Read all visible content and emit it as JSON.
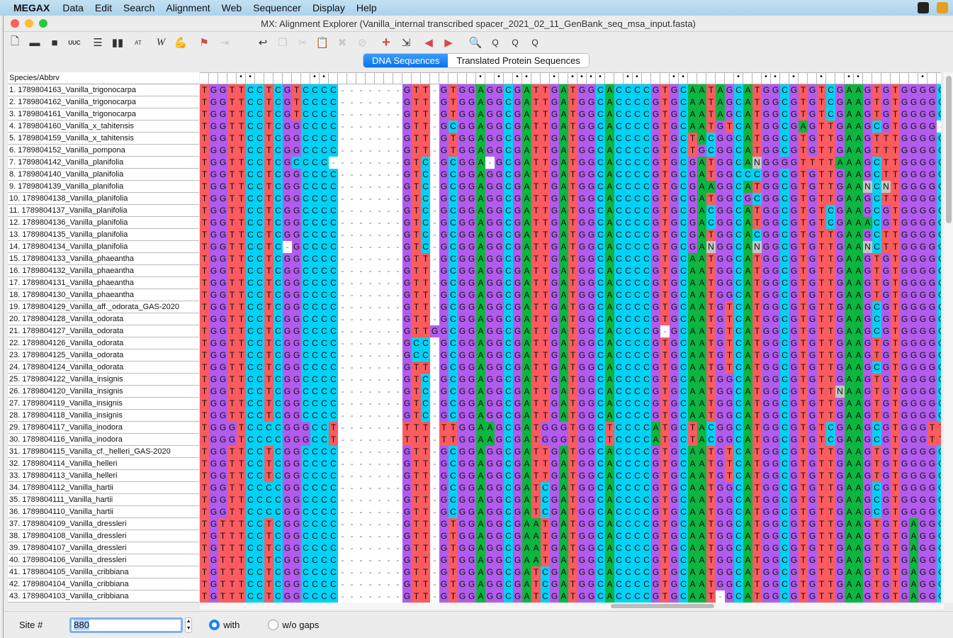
{
  "menubar": {
    "app": "MEGAX",
    "items": [
      "Data",
      "Edit",
      "Search",
      "Alignment",
      "Web",
      "Sequencer",
      "Display",
      "Help"
    ],
    "right_icons": [
      "camera-icon",
      "shield-icon"
    ]
  },
  "window": {
    "title": "MX: Alignment Explorer (Vanilla_internal transcribed spacer_2021_02_11_GenBank_seq_msa_input.fasta)"
  },
  "toolbar": {
    "icons": [
      "new-icon",
      "open-folder-icon",
      "save-icon",
      "translate-icon",
      "document-icon",
      "split-icon",
      "atcg-icon",
      "w-icon",
      "muscle-icon",
      "flag-icon",
      "insert-gap-icon",
      "undo-icon",
      "copy-icon",
      "cut-icon",
      "paste-icon",
      "delete-icon",
      "delete-gap-icon",
      "add-icon",
      "import-icon",
      "move-left-icon",
      "move-right-icon",
      "search-icon",
      "search-previous-icon",
      "search-next-icon",
      "search-flag-icon"
    ]
  },
  "tabs": [
    {
      "label": "DNA Sequences",
      "active": true
    },
    {
      "label": "Translated Protein Sequences",
      "active": false
    }
  ],
  "colors": {
    "A": "#0cb640",
    "C": "#00d2f6",
    "G": "#b25ced",
    "T": "#fc5b60",
    "N": "#c4c4c4",
    "-": "#ffffff"
  },
  "alignment": {
    "header": "Species/Abbrv",
    "conserved": "    **      **                * * **  * ****  **   **     *  ** *  *  **      *  ",
    "rows": [
      {
        "name": "1. 1789804163_Vanilla_trigonocarpa",
        "seq": "TGGTTCCTCGTCCCC-------GTT-GTGGAGGCGATTGATGGCACCCCGTGCAATAGCATGGCGTGTCGAAGTGTGGGGC"
      },
      {
        "name": "2. 1789804162_Vanilla_trigonocarpa",
        "seq": "TGGTTCCTCGTCCCC-------GTT-GTGGAGGCGATTGATGGCACCCCGTGCAATAGCATGGCGTGTCGAAGTGTGGGGC"
      },
      {
        "name": "3. 1789804161_Vanilla_trigonocarpa",
        "seq": "TGGTTCCTCGTCCCC-------GTT-GTGGAGGCGATTGATGGCACCCCGTGCAATAGCATGGCGTGTCGAAGTGTGGGGC"
      },
      {
        "name": "4. 1789804160_Vanilla_x_tahitensis",
        "seq": "TGGTTCCTCGGCCCC-------GTT-GCGGAGGCGATTGATGGCACCCCGTGCAATGTCATGGCGAGTTGAAGCGTGGGG-"
      },
      {
        "name": "5. 1789804159_Vanilla_x_tahitensis",
        "seq": "TGGTTCCTCGGCCCC-------GTT-GTGGAGGCGATTGATGGCACCCCGTGCTACGGCATGGCGTGTTGAAGTTTGGGGC"
      },
      {
        "name": "6. 1789804152_Vanilla_pompona",
        "seq": "TGGTTCCTCGGCCCC-------GTT-GTGGAGGCGATTGATGGCACCCCGTGCTGCGGCATGGCGTGTTGAAGTTTGGGGC"
      },
      {
        "name": "7. 1789804142_Vanilla_planifolia",
        "seq": "TGGTTCCTCGCCCC--------GTC-GCGGA-GCGATTGATGGCACCCCGTGCGATGGCANGGGGTTTTAAAGCTTGGGGC"
      },
      {
        "name": "8. 1789804140_Vanilla_planifolia",
        "seq": "TGGTTCCTCGGCCCC-------GTC-GCGGAGGCGATTGATGGCACCCCGTGCGATGGCCCGGCGTGTTGAAGCTTGGGGC"
      },
      {
        "name": "9. 1789804139_Vanilla_planifolia",
        "seq": "TGGTTCCTCGGCCCC-------GTC-GCGGAGGCGATTGATGGCACCCCGTGCGAAGGCATGGCGTGTTGAANCNTGGGGC"
      },
      {
        "name": "10. 1789804138_Vanilla_planifolia",
        "seq": "TGGTTCCTCGGCCCC-------GTC-GCGGAGGCGATTGATGGCACCCCGTGCGATGGCGCGGCGTGTTGAAGCTTGGGGC"
      },
      {
        "name": "11. 1789804137_Vanilla_planifolia",
        "seq": "TGGTTCCTCGGCCCC-------GTC-GCGGAGGCGATTGATGGCACCCCGTGCGACGGCATGGCGTGTCGAAGCGTGGGGC"
      },
      {
        "name": "12. 1789804136_Vanilla_planifolia",
        "seq": "TGGTTCCTCGGCCCC-------GTC-GCGGAGGCGATTGATGGCACCCCGTGCGACGGCATGGCGTGTCGAAACGTGGGGC"
      },
      {
        "name": "13. 1789804135_Vanilla_planifolia",
        "seq": "TGGTTCCTCGGCCCC-------GTC-GCGGAGGCGATTGATGGCACCCCGTGCGATGGCACGGCGTGTTGAAGCTTGGGGC"
      },
      {
        "name": "14. 1789804134_Vanilla_planifolia",
        "seq": "TGGTTCCTC-GCCCC-------GTC-GCGGAGGCGATTGATGGCACCCCGTGCGANGGCANGGCGTGTTGAANCTTGGGGC"
      },
      {
        "name": "15. 1789804133_Vanilla_phaeantha",
        "seq": "TGGTTCCTCGGCCCC-------GTT-GCGGAGGCGATTGATGGCACCCCGTGCAATGGCATGGCGTGTTGAAGTGTGGGGC"
      },
      {
        "name": "16. 1789804132_Vanilla_phaeantha",
        "seq": "TGGTTCCTCGGCCCC-------GTT-GCGGAGGCGATTGATGGCACCCCGTGCAATGGCATGGCGTGTTGAAGTGTGGGGC"
      },
      {
        "name": "17. 1789804131_Vanilla_phaeantha",
        "seq": "TGGTTCCTCGGCCCC-------GTT-GCGGAGGCGATTGATGGCACCCCGTGCAATGGCATGGCGTGTTGAAGTGTGGGGC"
      },
      {
        "name": "18. 1789804130_Vanilla_phaeantha",
        "seq": "TGGTTCCTCGGCCCC-------GTT-GCGGAGGCGATTGATGGCACCCCGTGCAATGGCATGGCGTGTTGAAGTGTGGGGC"
      },
      {
        "name": "19. 1789804129_Vanilla_aff._odorata_GAS-2020",
        "seq": "TGGTTCCTCGGCCCC-------GTT-GCGGAGGCGATTGATGGCACCCCGTGCAATGTCATGGCGTGTTGAAGCGTGGGGC"
      },
      {
        "name": "20. 1789804128_Vanilla_odorata",
        "seq": "TGGTTCCTCGGCCCC-------GTT-GCGGAGGCGATTGATGGCACCCCGTGCAATGTCATGGCGTGTTGAAGCGTGGGGC"
      },
      {
        "name": "21. 1789804127_Vanilla_odorata",
        "seq": "TGGTTCCTCGGCCCC-------GTTGGCGGAGGCGATTGATGGCACCCCG-GCAATGTCATGGCGTGTTGAAGCGTGGGGC"
      },
      {
        "name": "22. 1789804126_Vanilla_odorata",
        "seq": "TGGTTCCTCGGCCCC-------GCC-GCGGAGGCGATTGATGGCACCCCGTGCAATGTCATGGCGTGTTGAAGTGTGGGGC"
      },
      {
        "name": "23. 1789804125_Vanilla_odorata",
        "seq": "TGGTTCCTCGGCCCC-------GCC-GCGGAGGCGATTGATGGCACCCCGTGCAATGTCATGGCGTGTTGAAGTGTGGGGC"
      },
      {
        "name": "24. 1789804124_Vanilla_odorata",
        "seq": "TGGTTCCTCGGCCCC-------GTT-GCGGAGGCGATTGATGGCACCCCGTGCAATGTCATGGCGTGTTGAAGCGTGGGGC"
      },
      {
        "name": "25. 1789804122_Vanilla_insignis",
        "seq": "TGGTTCCTCGGCCCC-------GTC-GCGGAGGCGATTGATGGCACCCCGTGCAATGGCATGGCGTGTTGAAGTGTGGGGC"
      },
      {
        "name": "26. 1789804120_Vanilla_insignis",
        "seq": "TGGTTCCTCGGCCCC-------GTC-GCGGAGGCGATTGATGGCACCCCGTGCAATGGCATGGCGTGTTNAAGTGTGGGGC"
      },
      {
        "name": "27. 1789804119_Vanilla_insignis",
        "seq": "TGGTTCCTCGGCCCC-------GTC-GCGGAGGCGATTGATGGCACCCCGTGCAATGGCATGGCGTGTTGAAGTGTGGGGC"
      },
      {
        "name": "28. 1789804118_Vanilla_insignis",
        "seq": "TGGTTCCTCGGCCCC-------GTC-GCGGAGGCGATTGATGGCACCCCGTGCAATGGCATGGCGTGTTGAAGTGTGGGGC"
      },
      {
        "name": "29. 1789804117_Vanilla_inodora",
        "seq": "TGGGTCCCCGGGCCT-------TTT-TTGGAAGCGATGGGTGGCTCCCCATGCTACGGCATGGCGTGTCGAAGCGTGGGTT"
      },
      {
        "name": "30. 1789804116_Vanilla_inodora",
        "seq": "TGGGTCCCCGGGCCT-------TTT-TTGGAAGCGATGGGTGGCTCCCCATGCTACGGCATGGCGTGTCGAAGCGTGGGTT"
      },
      {
        "name": "31. 1789804115_Vanilla_cf._helleri_GAS-2020",
        "seq": "TGGTTCCTCGGCCCC-------GTT-GCGGAGGCGATTGATGGCACCCCGTGCAATGTCATGGCGTGTTGAAGTGTGGGGC"
      },
      {
        "name": "32. 1789804114_Vanilla_helleri",
        "seq": "TGGTTCCTCGGCCCC-------GTT-GCGGAGGCGATTGATGGCACCCCGTGCAATGTCATGGCGTGTTGAAGTGTGGGGC"
      },
      {
        "name": "33. 1789804113_Vanilla_helleri",
        "seq": "TGGTTCCTCGGCCCC-------GTT-GCGGAGGCGATTGATGGCACCCCGTGCAATGTCATGGCGTGTTGAAGTGTGGGGC"
      },
      {
        "name": "34. 1789804112_Vanilla_hartii",
        "seq": "TGGTTCCCCGGCCCC-------GTT-GCGGAGGCGATCGATGGCACCCCGTGCAATGGCATGGCGTGTTGAAGCGTGGGGC"
      },
      {
        "name": "35. 1789804111_Vanilla_hartii",
        "seq": "TGGTTCCCCGGCCCC-------GTT-GCGGAGGCGATCGATGGCACCCCGTGCAATGGCATGGCGTGTTGAAGCGTGGGGC"
      },
      {
        "name": "36. 1789804110_Vanilla_hartii",
        "seq": "TGGTTCCCCGGCCCC-------GTT-GCGGAGGCGATCGATGGCACCCCGTGCAATGGCATGGCGTGTTGAAGCGTGGGGC"
      },
      {
        "name": "37. 1789804109_Vanilla_dressleri",
        "seq": "TGTTTCCTCGGCCCC-------GTT-GTGGAGGCGAATGATGGCACCCCGTGCAATGGCATGGCGTGTTGAAGTGTGAGGC"
      },
      {
        "name": "38. 1789804108_Vanilla_dressleri",
        "seq": "TGTTTCCTCGGCCCC-------GTT-GTGGAGGCGAATGATGGCACCCCGTGCAATGGCATGGCGTGTTGAAGTGTGAGGC"
      },
      {
        "name": "39. 1789804107_Vanilla_dressleri",
        "seq": "TGTTTCCTCGGCCCC-------GTT-GTGGAGGCGAATGATGGCACCCCGTGCAATGGCATGGCGTGTTGAAGTGTGAGGC"
      },
      {
        "name": "40. 1789804106_Vanilla_dressleri",
        "seq": "TGTTTCCTCGGCCCC-------GTT-GTGGAGGCGAATGATGGCACCCCGTGCAATGGCATGGCGTGTTGAAGTGTGAGGC"
      },
      {
        "name": "41. 1789804105_Vanilla_cribbiana",
        "seq": "TGTTTCCTCGGCCCC-------GTT-GTGGAGGCGATCGATGGCACCCCGTGCAATGGCATGGCGTGTTGAAGTGTGAGGC"
      },
      {
        "name": "42. 1789804104_Vanilla_cribbiana",
        "seq": "TGTTTCCTCGGCCCC-------GTT-GTGGAGGCGATCGATGGCACCCCGTGCAATGGCATGGCGTGTTGAAGTGTGAGGC"
      },
      {
        "name": "43. 1789804103_Vanilla_cribbiana",
        "seq": "TGTTTCCTCGGCCCC-------GTT-GTGGAGGCGATCGATGGCACCCCGTGCAAT-GCATGGCGTGTTGAAGTGTGAGGC"
      }
    ]
  },
  "footer": {
    "site_label": "Site #",
    "site_value": "880",
    "radio_with": "with",
    "radio_without": "w/o gaps",
    "selected": "with"
  }
}
